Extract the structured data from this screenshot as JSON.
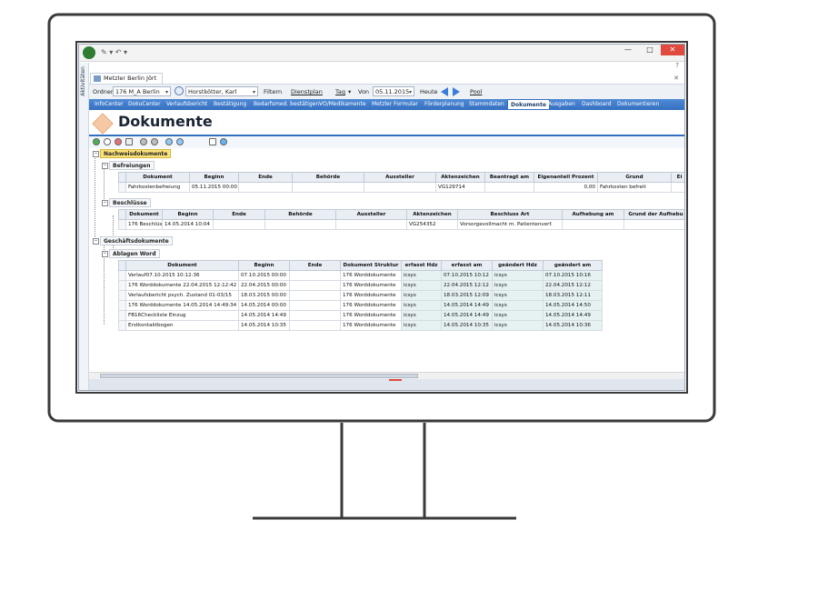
{
  "window": {
    "tab_label": "Metzler Berlin Jört",
    "min_glyph": "—",
    "max_glyph": "□",
    "close_glyph": "✕",
    "help_glyph": "?",
    "tab_close_glyph": "✕",
    "sidebar_label": "Aktivitäten"
  },
  "toolbar": {
    "ordner_label": "Ordner",
    "ordner_value": "176 M_A Berlin",
    "person_value": "Horstkötter, Karl",
    "filter_label": "Filtern",
    "dienstplan_label": "Dienstplan",
    "tag_label": "Tag",
    "von_label": "Von",
    "date_value": "05.11.2015",
    "heute_label": "Heute",
    "pool_label": "Pool"
  },
  "nav": {
    "items": [
      "InfoCenter",
      "DokuCenter",
      "Verlaufsbericht",
      "Bestätigung",
      "Bedarfsmed. bestätigen",
      "VO/Medikamente",
      "Metzler Formular",
      "Förderplanung",
      "Stammdaten",
      "Dokumente",
      "Ausgaben",
      "Dashboard",
      "Dokumentieren"
    ],
    "active": "Dokumente"
  },
  "page": {
    "title": "Dokumente"
  },
  "tree": {
    "nachweis": "Nachweisdokumente",
    "befreiungen": "Befreiungen",
    "beschluesse": "Beschlüsse",
    "geschaeft": "Geschäftsdokumente",
    "ablagen": "Ablagen Word"
  },
  "befreiungen_table": {
    "columns": [
      "Dokument",
      "Beginn",
      "Ende",
      "Behörde",
      "Aussteller",
      "Aktenzeichen",
      "Beantragt am",
      "Eigenanteil Prozent",
      "Grund",
      "Ei"
    ],
    "row": [
      "Fahrkostenbefreiung",
      "05.11.2015 00:00",
      "",
      "",
      "",
      "VG129714",
      "",
      "0,00",
      "Fahrkosten befreit",
      ""
    ]
  },
  "beschluesse_table": {
    "columns": [
      "Dokument",
      "Beginn",
      "Ende",
      "Behörde",
      "Aussteller",
      "Aktenzeichen",
      "Beschluss Art",
      "Aufhebung am",
      "Grund der Aufhebu"
    ],
    "row": [
      "176 Beschlüsse",
      "14.05.2014 10:04",
      "",
      "",
      "",
      "VG254352",
      "Vorsorgevollmacht m. Patientenverf.",
      "",
      ""
    ]
  },
  "ablagen_table": {
    "columns": [
      "Dokument",
      "Beginn",
      "Ende",
      "Dokument Struktur",
      "erfasst Hdz",
      "erfasst am",
      "geändert Hdz",
      "geändert am"
    ],
    "rows": [
      [
        "Verlauf07.10.2015 10:12:36",
        "07.10.2015 00:00",
        "",
        "176 Worddokumente",
        "icsys",
        "07.10.2015 10:12",
        "icsys",
        "07.10.2015 10:16"
      ],
      [
        "176 Worddokumente 22.04.2015 12:12:42",
        "22.04.2015 00:00",
        "",
        "176 Worddokumente",
        "icsys",
        "22.04.2015 12:12",
        "icsys",
        "22.04.2015 12:12"
      ],
      [
        "Verlaufsbericht psych. Zustand 01-03/15",
        "18.03.2015 00:00",
        "",
        "176 Worddokumente",
        "icsys",
        "18.03.2015 12:09",
        "icsys",
        "18.03.2015 12:11"
      ],
      [
        "176 Worddokumente 14.05.2014 14:49:34",
        "14.05.2014 00:00",
        "",
        "176 Worddokumente",
        "icsys",
        "14.05.2014 14:49",
        "icsys",
        "14.05.2014 14:50"
      ],
      [
        "FB16Checkliste Einzug",
        "14.05.2014 14:49",
        "",
        "176 Worddokumente",
        "icsys",
        "14.05.2014 14:49",
        "icsys",
        "14.05.2014 14:49"
      ],
      [
        "Erstkontaktbogen",
        "14.05.2014 10:35",
        "",
        "176 Worddokumente",
        "icsys",
        "14.05.2014 10:35",
        "icsys",
        "14.05.2014 10:36"
      ]
    ]
  },
  "colors": {
    "nav_bar": "#3470c0",
    "group_highlight": "#fbe27a",
    "close_button": "#e04a3f",
    "shaded_column": "#e6f1f1"
  }
}
